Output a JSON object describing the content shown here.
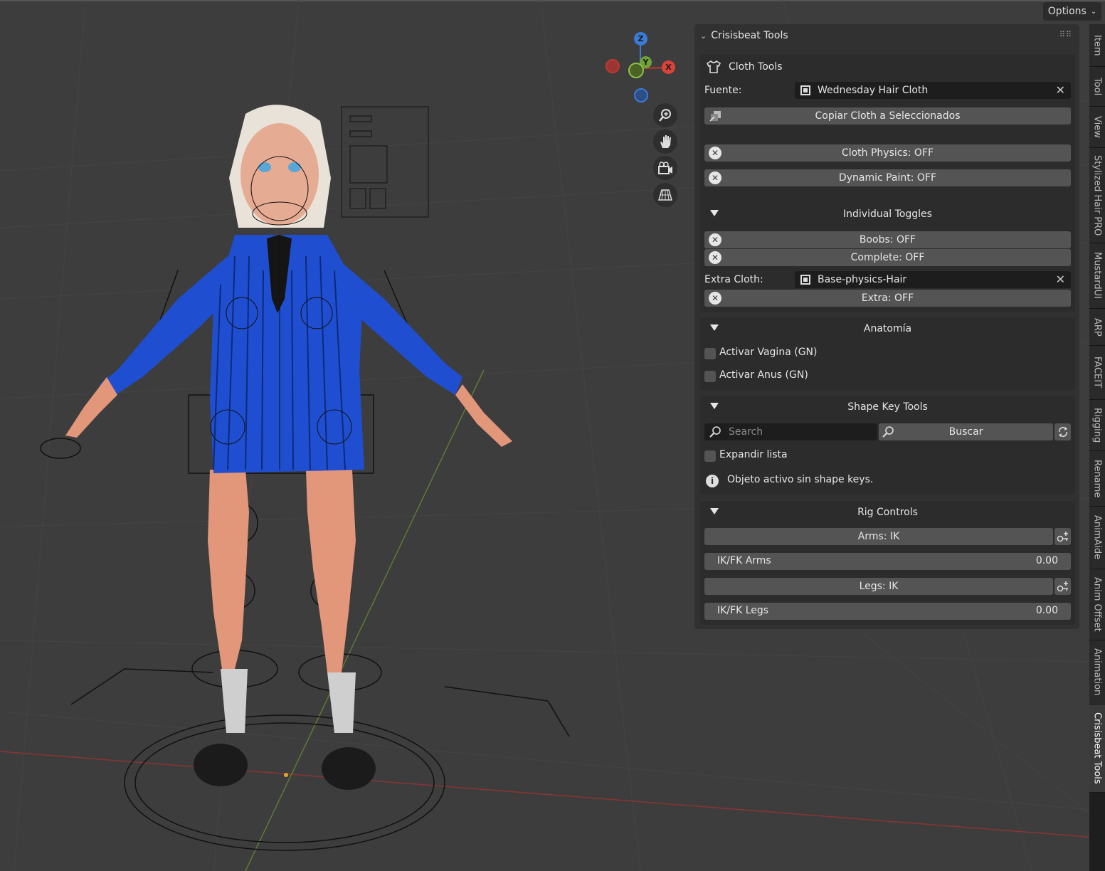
{
  "header": {
    "options_label": "Options"
  },
  "gizmo": {
    "z": "Z",
    "y": "Y",
    "x": "X"
  },
  "panel": {
    "title": "Crisisbeat Tools",
    "cloth_tools": {
      "title": "Cloth Tools",
      "source_label": "Fuente:",
      "source_value": "Wednesday Hair Cloth",
      "copy_button": "Copiar Cloth a Seleccionados",
      "cloth_physics": "Cloth Physics: OFF",
      "dynamic_paint": "Dynamic Paint: OFF"
    },
    "individual_toggles": {
      "title": "Individual Toggles",
      "boobs": "Boobs: OFF",
      "complete": "Complete: OFF",
      "extra_cloth_label": "Extra Cloth:",
      "extra_cloth_value": "Base-physics-Hair",
      "extra": "Extra: OFF"
    },
    "anatomia": {
      "title": "Anatomía",
      "vagina": "Activar Vagina (GN)",
      "anus": "Activar Anus (GN)"
    },
    "shape_key_tools": {
      "title": "Shape Key Tools",
      "search_placeholder": "Search",
      "search_button": "Buscar",
      "expand_label": "Expandir lista",
      "info_text": "Objeto activo sin shape keys."
    },
    "rig_controls": {
      "title": "Rig Controls",
      "arms_button": "Arms: IK",
      "ikfk_arms_label": "IK/FK Arms",
      "ikfk_arms_value": "0.00",
      "legs_button": "Legs: IK",
      "ikfk_legs_label": "IK/FK Legs",
      "ikfk_legs_value": "0.00"
    }
  },
  "tabs": [
    "Item",
    "Tool",
    "View",
    "Stylized Hair PRO",
    "MustardUI",
    "ARP",
    "FACEIT",
    "Rigging",
    "Rename",
    "AnimAide",
    "Anim Offset",
    "Animation",
    "Crisisbeat Tools"
  ],
  "colors": {
    "viewport_bg": "#3d3d3d",
    "x_axis": "#c0392b",
    "y_axis": "#6b8e23",
    "z_axis": "#3b7bd6",
    "jacket_blue": "#1f4fd0"
  }
}
